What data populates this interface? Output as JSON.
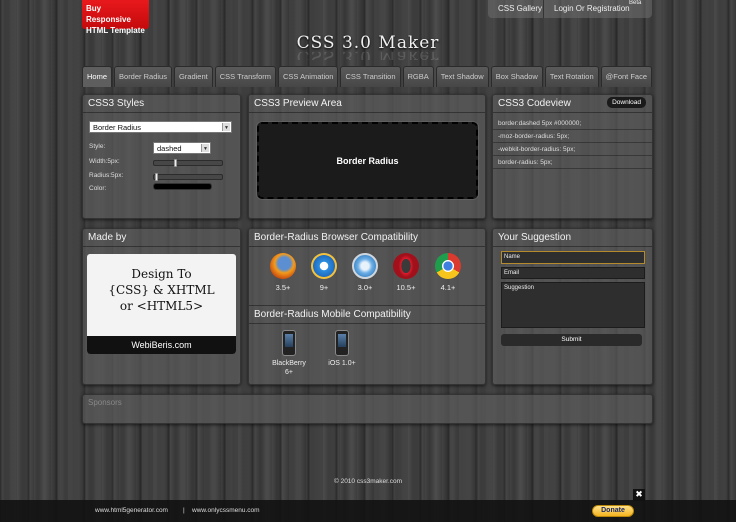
{
  "promo": {
    "line1": "Buy Responsive",
    "line2": "HTML Template"
  },
  "topnav": {
    "gallery": "CSS Gallery",
    "login": "Login Or Registration",
    "beta": "Beta"
  },
  "logo": "CSS 3.0 Maker",
  "tabs": [
    {
      "label": "Home"
    },
    {
      "label": "Border Radius"
    },
    {
      "label": "Gradient"
    },
    {
      "label": "CSS Transform"
    },
    {
      "label": "CSS Animation"
    },
    {
      "label": "CSS Transition"
    },
    {
      "label": "RGBA"
    },
    {
      "label": "Text Shadow"
    },
    {
      "label": "Box Shadow"
    },
    {
      "label": "Text Rotation"
    },
    {
      "label": "@Font Face"
    }
  ],
  "styles": {
    "title": "CSS3 Styles",
    "selected": "Border Radius",
    "style_label": "Style:",
    "style_value": "dashed",
    "width_label": "Width:5px:",
    "width_value": 0.3,
    "radius_label": "Radius:5px:",
    "radius_value": 0.02,
    "color_label": "Color:",
    "color_value": "#000000"
  },
  "preview": {
    "title": "CSS3 Preview Area",
    "box_text": "Border Radius"
  },
  "codeview": {
    "title": "CSS3 Codeview",
    "download": "Download",
    "lines": [
      "border:dashed 5px #000000;",
      "-moz-border-radius: 5px;",
      "-webkit-border-radius: 5px;",
      "border-radius: 5px;"
    ]
  },
  "madeby": {
    "title": "Made by",
    "line1": "Design To",
    "line2": "{CSS} & XHTML",
    "line3": "or <HTML5>",
    "footer": "WebiBeris.com"
  },
  "compat": {
    "browser_title": "Border-Radius Browser Compatibility",
    "browsers": [
      {
        "icon": "firefox-icon",
        "version": "3.5+"
      },
      {
        "icon": "ie-icon",
        "version": "9+"
      },
      {
        "icon": "safari-icon",
        "version": "3.0+"
      },
      {
        "icon": "opera-icon",
        "version": "10.5+"
      },
      {
        "icon": "chrome-icon",
        "version": "4.1+"
      }
    ],
    "mobile_title": "Border-Radius Mobile Compatibility",
    "mobiles": [
      {
        "icon": "blackberry-icon",
        "line1": "BlackBerry",
        "line2": "6+"
      },
      {
        "icon": "iphone-icon",
        "line1": "iOS 1.0+",
        "line2": ""
      }
    ]
  },
  "suggestion": {
    "title": "Your Suggestion",
    "name": "Name",
    "email": "Email",
    "suggestion": "Suggestion",
    "submit": "Submit"
  },
  "sponsors": {
    "title": "Sponsors"
  },
  "copyright": "© 2010 css3maker.com",
  "footer": {
    "link1": "www.html5generator.com",
    "pipe": "|",
    "link2": "www.onlycssmenu.com",
    "donate": "Donate",
    "close": "✖"
  }
}
